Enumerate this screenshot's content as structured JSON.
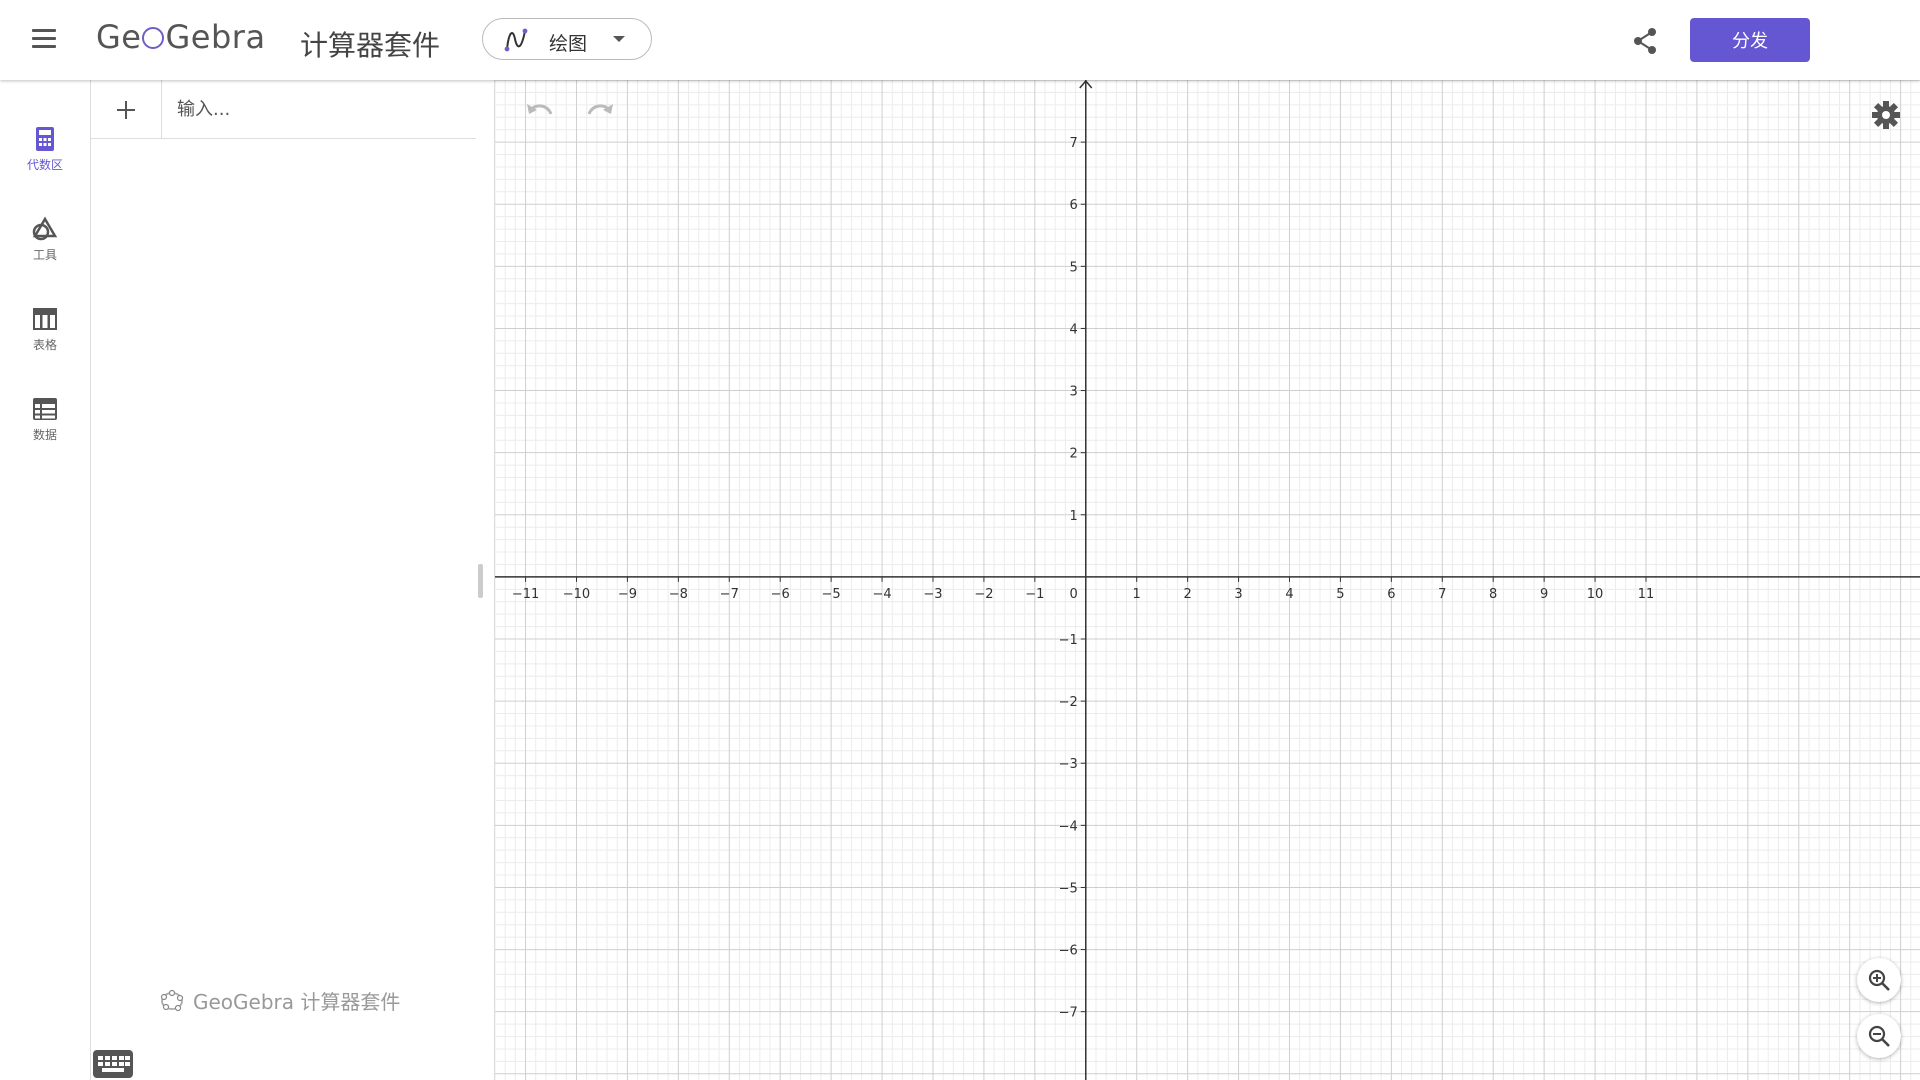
{
  "header": {
    "logo_text": "GeoGebra",
    "suite_title": "计算器套件",
    "app_picker_label": "绘图",
    "publish_label": "分发"
  },
  "rail": {
    "items": [
      {
        "label": "代数区",
        "icon": "calculator-icon",
        "active": true
      },
      {
        "label": "工具",
        "icon": "shapes-icon",
        "active": false
      },
      {
        "label": "表格",
        "icon": "table-icon",
        "active": false
      },
      {
        "label": "数据",
        "icon": "data-sheet-icon",
        "active": false
      }
    ]
  },
  "algebra": {
    "input_placeholder": "输入...",
    "footer_brand": "GeoGebra 计算器套件"
  },
  "graphics": {
    "x_ticks": [
      -11,
      -10,
      -9,
      -8,
      -7,
      -6,
      -5,
      -4,
      -3,
      -2,
      -1,
      1,
      2,
      3,
      4,
      5,
      6,
      7,
      8,
      9,
      10,
      11
    ],
    "y_ticks": [
      7,
      6,
      5,
      4,
      3,
      2,
      1,
      -1,
      -2,
      -3,
      -4,
      -5,
      -6,
      -7
    ],
    "origin_label": "0",
    "x_range": [
      -11.6,
      16.4
    ],
    "y_range": [
      -8.1,
      8.0
    ]
  },
  "colors": {
    "accent": "#6557d2",
    "grid_major": "#cfcfcf",
    "grid_minor": "#ececec",
    "axis": "#333333"
  }
}
